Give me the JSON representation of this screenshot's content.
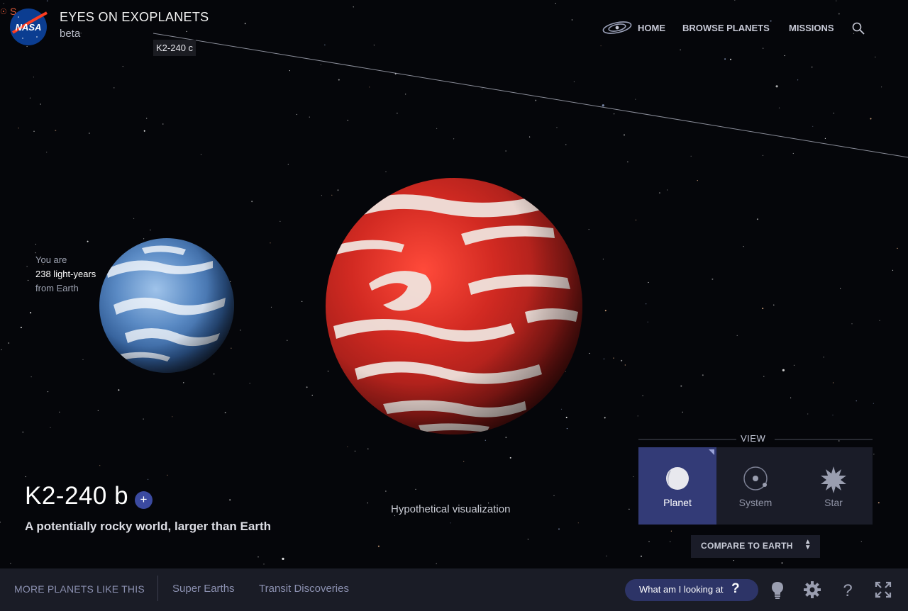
{
  "header": {
    "logo_text": "NASA",
    "app_title": "EYES ON EXOPLANETS",
    "app_subtitle": "beta",
    "corner_fragment": "S"
  },
  "nav": {
    "items": [
      {
        "label": "HOME",
        "icon": "galaxy-icon"
      },
      {
        "label": "BROWSE PLANETS"
      },
      {
        "label": "MISSIONS"
      }
    ],
    "search_icon": "search-icon"
  },
  "scene": {
    "orbit_label": "K2-240 c",
    "distance": {
      "line1": "You are",
      "line2": "238 light-years",
      "line3": "from Earth"
    },
    "earth_planet": "earth",
    "target_planet": "K2-240 b visualization",
    "hypothetical_label": "Hypothetical visualization"
  },
  "planet": {
    "name": "K2-240 b",
    "add_symbol": "+",
    "description": "A potentially rocky world, larger than Earth"
  },
  "view": {
    "label": "VIEW",
    "options": [
      {
        "label": "Planet",
        "icon": "planet-icon",
        "active": true
      },
      {
        "label": "System",
        "icon": "system-icon",
        "active": false
      },
      {
        "label": "Star",
        "icon": "star-icon",
        "active": false
      }
    ],
    "compare_label": "COMPARE TO EARTH",
    "compare_arrows": "▲\n▼"
  },
  "bottom": {
    "more_label": "MORE PLANETS LIKE THIS",
    "tags": [
      "Super Earths",
      "Transit Discoveries"
    ],
    "what_label": "What am I looking at",
    "what_symbol": "?",
    "tools": [
      "lightbulb-icon",
      "settings-gear-icon",
      "help-icon",
      "fullscreen-icon"
    ]
  },
  "colors": {
    "background": "#05060a",
    "accent_blue": "#333b77",
    "panel": "#1a1c28",
    "bottom_bar": "#1a1c26",
    "nasa_blue": "#0b3d91",
    "nasa_red": "#fc3d21",
    "planet_red": "#c42a22"
  }
}
